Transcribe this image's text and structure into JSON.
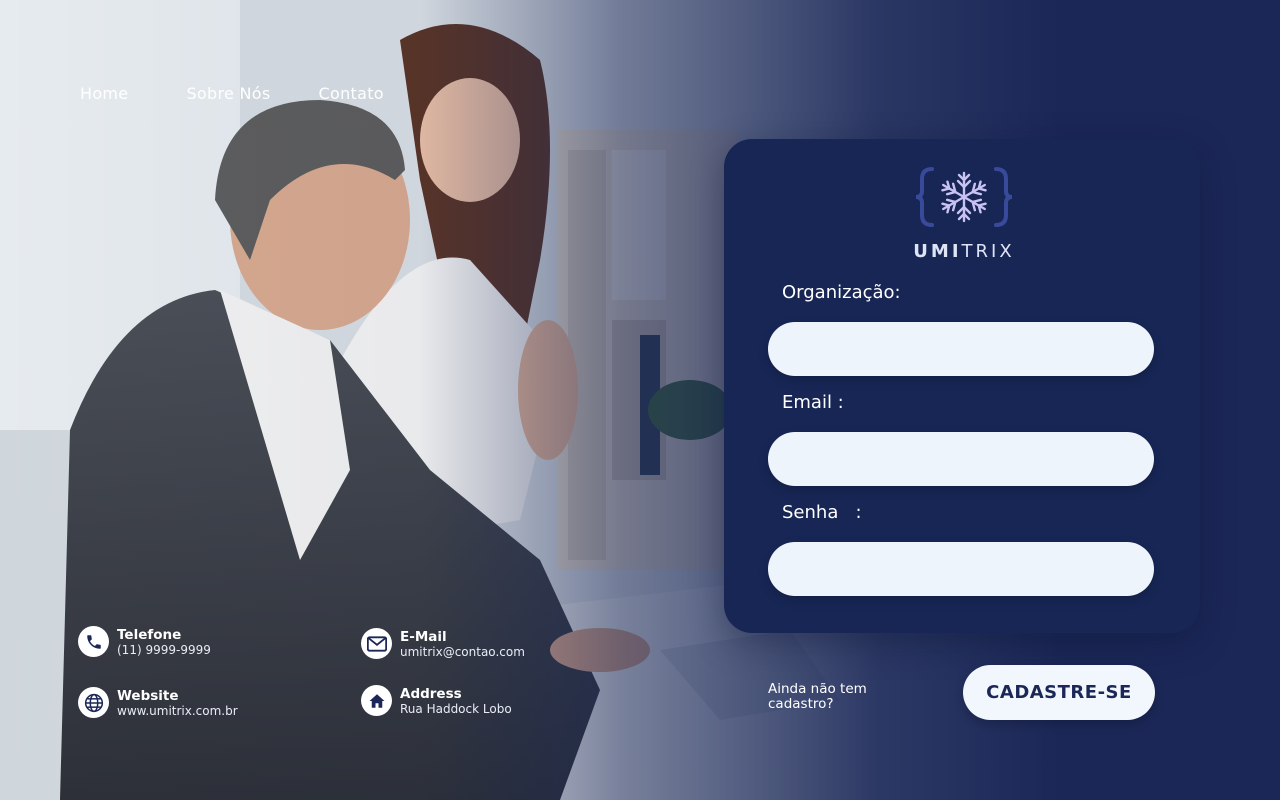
{
  "nav": {
    "items": [
      "Home",
      "Sobre Nós",
      "Contato"
    ]
  },
  "brand": {
    "name_bold": "UMI",
    "name_light": "TRIX",
    "logo_icon": "snowflake-in-braces-icon"
  },
  "form": {
    "organization_label": "Organização:",
    "email_label": "Email :",
    "password_label": "Senha   :",
    "organization_value": "",
    "email_value": "",
    "password_value": ""
  },
  "signup": {
    "question": "Ainda não tem cadastro?",
    "button_label": "CADASTRE-SE"
  },
  "contacts": {
    "phone": {
      "title": "Telefone",
      "value": "(11) 9999-9999",
      "icon": "phone-icon"
    },
    "email": {
      "title": "E-Mail",
      "value": "umitrix@contao.com",
      "icon": "envelope-icon"
    },
    "website": {
      "title": "Website",
      "value": "www.umitrix.com.br",
      "icon": "globe-icon"
    },
    "address": {
      "title": "Address",
      "value": "Rua Haddock Lobo",
      "icon": "home-icon"
    }
  },
  "colors": {
    "navy": "#1b2757",
    "card": "#172655",
    "field": "#eef4fb",
    "logo_lavender": "#c9c2f2",
    "logo_brace": "#3a4a9a"
  }
}
